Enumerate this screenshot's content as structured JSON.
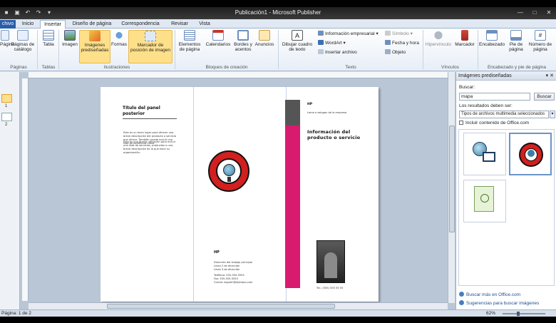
{
  "titlebar": {
    "title": "Publicación1 - Microsoft Publisher"
  },
  "tabs": [
    {
      "label": "chivo"
    },
    {
      "label": "Inicio"
    },
    {
      "label": "Insertar"
    },
    {
      "label": "Diseño de página"
    },
    {
      "label": "Correspondencia"
    },
    {
      "label": "Revisar"
    },
    {
      "label": "Vista"
    }
  ],
  "ribbon": {
    "paginas": {
      "b1": "Página",
      "b2": "Páginas de catálogo",
      "group": "Páginas"
    },
    "tablas": {
      "b1": "Tabla",
      "group": "Tablas"
    },
    "ilustraciones": {
      "imagen": "Imagen",
      "predis": "Imágenes prediseñadas",
      "formas": "Formas",
      "marcador": "Marcador de posición de imagen",
      "group": "Ilustraciones"
    },
    "bloques": {
      "elementos": "Elementos de página",
      "calendarios": "Calendarios",
      "bordes": "Bordes y acentos",
      "anuncios": "Anuncios",
      "group": "Bloques de creación"
    },
    "texto": {
      "dibujar": "Dibujar cuadro de texto",
      "info": "Información empresarial",
      "wordart": "WordArt",
      "archivo": "Insertar archivo",
      "simbolo": "Símbolo",
      "fecha": "Fecha y hora",
      "objeto": "Objeto",
      "group": "Texto"
    },
    "vinculos": {
      "hipervinculo": "Hipervínculo",
      "marcador": "Marcador",
      "group": "Vínculos"
    },
    "encabezado": {
      "enc": "Encabezado",
      "pie": "Pie de página",
      "num": "Número de página",
      "group": "Encabezado y pie de página"
    }
  },
  "nav": {
    "p1": "1",
    "p2": "2"
  },
  "document": {
    "panel_title": "Título del panel posterior",
    "panel_body": "Este es un buen lugar para ofrecer una breve descripción del producto o servicio que ofrece. También puede incluir una lista de beneficios clave.",
    "panel_body2": "Esta es una buena ubicación para incluir una lista de servicios, productos o una breve descripción de lo que hace su organización.",
    "hp1": "HP",
    "address_lines": [
      "Dirección del trabajo principal",
      "Línea 2 de dirección",
      "Línea 3 de dirección",
      "Teléfono: 555-555-5555",
      "Fax: 555-555-5555",
      "Correo: alguien@ejemplo.com"
    ],
    "hp2": "HP",
    "tagline": "Lema o eslogan de la empresa",
    "product_title": "Información del producto o servicio",
    "phone": "Tel.: (555) 555 55 55"
  },
  "taskpane": {
    "title": "Imágenes prediseñadas",
    "buscar_label": "Buscar:",
    "search_value": "mapa",
    "buscar_button": "Buscar",
    "results_label": "Los resultados deben ser:",
    "results_type": "Tipos de archivos multimedia seleccionados",
    "include_office": "Incluir contenido de Office.com",
    "link1": "Buscar más en Office.com",
    "link2": "Sugerencias para buscar imágenes"
  },
  "status": {
    "page": "Página: 1 de 2",
    "zoom": "62%"
  },
  "colors": {
    "accent": "#d81b6e",
    "file_tab": "#2a5ea8",
    "highlight": "#ffe08a"
  }
}
